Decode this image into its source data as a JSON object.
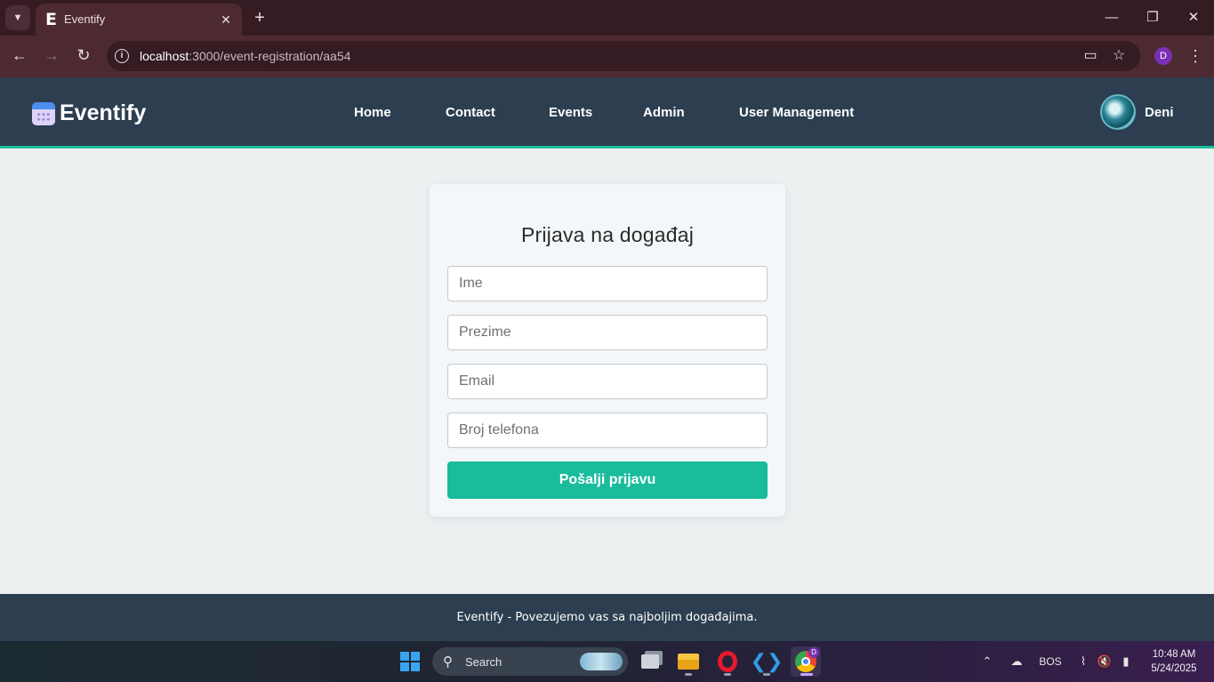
{
  "browser": {
    "tab_title": "Eventify",
    "tab_favicon": "E",
    "url_host": "localhost",
    "url_path": ":3000/event-registration/aa54",
    "profile_initial": "D",
    "icons": [
      "tab-search-icon",
      "close-icon",
      "new-tab-icon",
      "minimize-icon",
      "restore-icon",
      "back-icon",
      "forward-icon",
      "reload-icon",
      "site-info-icon",
      "install-app-icon",
      "bookmark-star-icon",
      "kebab-menu-icon"
    ]
  },
  "site": {
    "logo_text": "Eventify",
    "nav": [
      "Home",
      "Contact",
      "Events",
      "Admin",
      "User Management"
    ],
    "username": "Deni",
    "accent_color": "#1abc9c",
    "header_color": "#2c3e50"
  },
  "form": {
    "title": "Prijava na događaj",
    "fields": [
      {
        "placeholder": "Ime",
        "value": ""
      },
      {
        "placeholder": "Prezime",
        "value": ""
      },
      {
        "placeholder": "Email",
        "value": ""
      },
      {
        "placeholder": "Broj telefona",
        "value": ""
      }
    ],
    "submit_label": "Pošalji prijavu"
  },
  "footer": {
    "text": "Eventify - Povezujemo vas sa najboljim događajima."
  },
  "taskbar": {
    "search_label": "Search",
    "apps": [
      "task-view",
      "file-explorer",
      "opera",
      "vs-code",
      "chrome"
    ],
    "chrome_badge": "D",
    "language": "BOS",
    "time": "10:48 AM",
    "date": "5/24/2025"
  }
}
